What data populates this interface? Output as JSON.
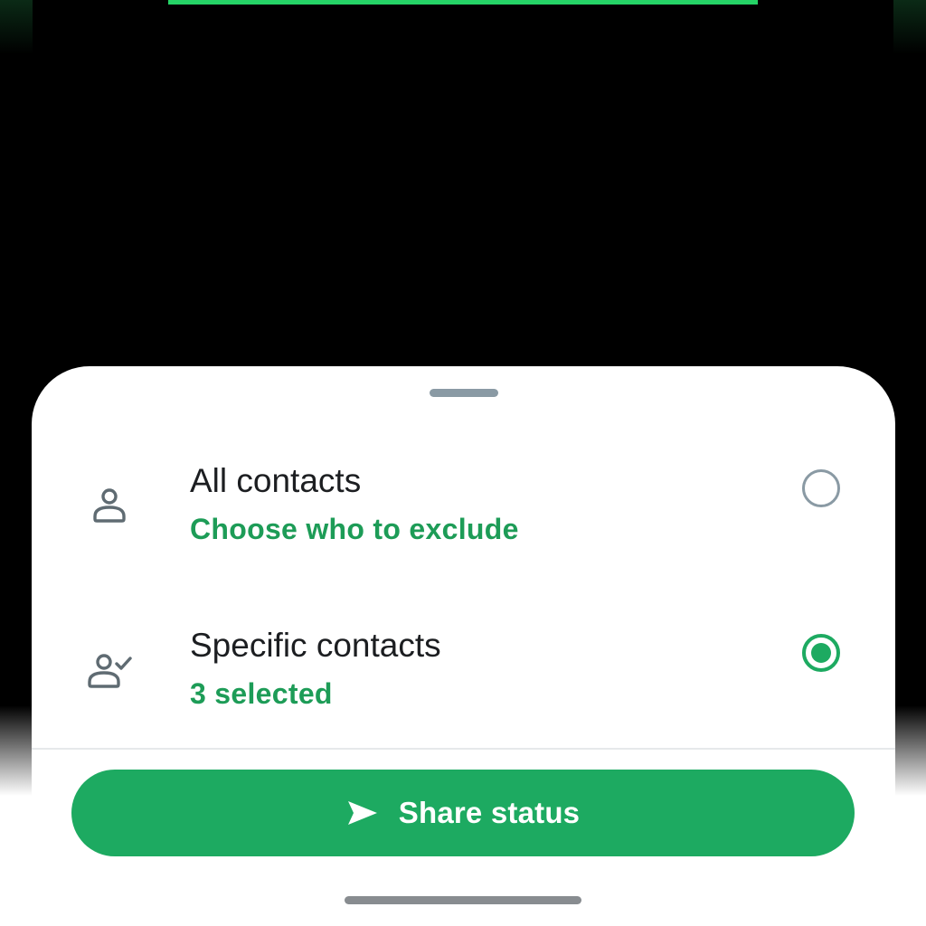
{
  "sheet": {
    "options": [
      {
        "title": "All contacts",
        "subtitle": "Choose who to exclude",
        "icon": "person-icon",
        "selected": false
      },
      {
        "title": "Specific contacts",
        "subtitle": "3 selected",
        "icon": "person-check-icon",
        "selected": true
      }
    ],
    "share_button": {
      "label": "Share status",
      "icon": "send-icon"
    }
  },
  "colors": {
    "accent_green": "#1daa61",
    "subtitle_green": "#1d9c57",
    "top_accent": "#25D366",
    "radio_inactive": "#8a9aa4",
    "background": "#000000"
  }
}
